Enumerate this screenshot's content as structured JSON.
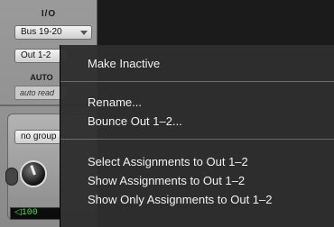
{
  "io": {
    "header": "I/O",
    "input_selector": "Bus 19-20",
    "output_selector": "Out 1-2"
  },
  "automation": {
    "header": "AUTO",
    "mode": "auto read"
  },
  "group": {
    "label": "no group"
  },
  "volume": {
    "readout": "◁100"
  },
  "menu": {
    "items": [
      {
        "label": "Make Inactive"
      },
      {
        "label": "Rename..."
      },
      {
        "label": "Bounce Out 1–2..."
      },
      {
        "label": "Select Assignments to Out 1–2"
      },
      {
        "label": "Show Assignments to Out 1–2"
      },
      {
        "label": "Show Only Assignments to Out 1–2"
      }
    ]
  },
  "colors": {
    "menu_background": "#2e2e2e",
    "menu_text": "#f2f2f2",
    "strip_background": "#9a9a9a",
    "meter_text": "#4ee04e"
  }
}
